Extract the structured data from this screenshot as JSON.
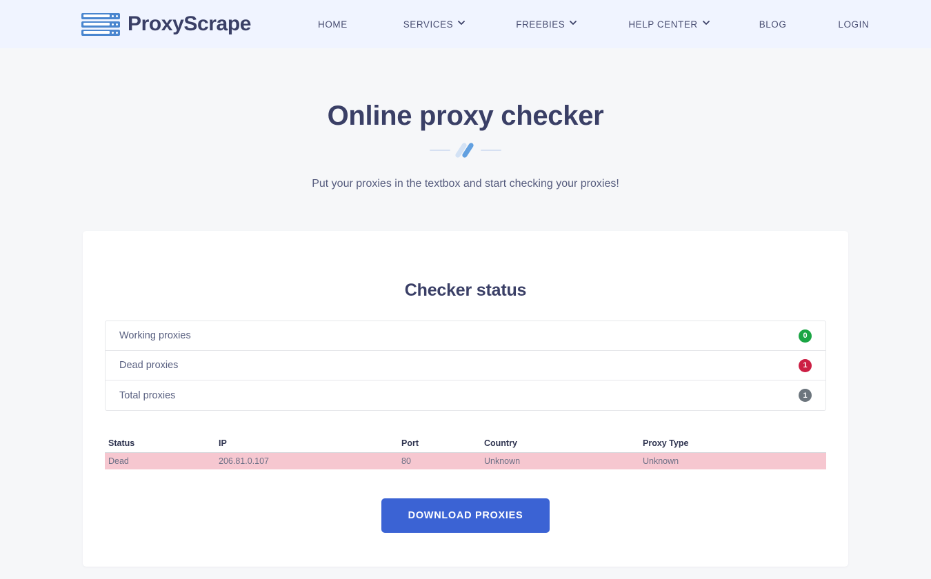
{
  "header": {
    "brand_name": "ProxyScrape",
    "logo_icon": "server-rack-icon",
    "nav": [
      {
        "label": "HOME",
        "has_caret": false
      },
      {
        "label": "SERVICES",
        "has_caret": true
      },
      {
        "label": "FREEBIES",
        "has_caret": true
      },
      {
        "label": "HELP CENTER",
        "has_caret": true
      },
      {
        "label": "BLOG",
        "has_caret": false
      },
      {
        "label": "LOGIN",
        "has_caret": false
      }
    ]
  },
  "hero": {
    "title": "Online proxy checker",
    "subtitle": "Put your proxies in the textbox and start checking your proxies!",
    "divider_icon": "double-slash-divider-icon"
  },
  "card": {
    "title": "Checker status",
    "status_rows": [
      {
        "label": "Working proxies",
        "count": "0",
        "color": "#1aa544"
      },
      {
        "label": "Dead proxies",
        "count": "1",
        "color": "#cc1f44"
      },
      {
        "label": "Total proxies",
        "count": "1",
        "color": "#6c757d"
      }
    ],
    "table": {
      "columns": [
        "Status",
        "IP",
        "Port",
        "Country",
        "Proxy Type"
      ],
      "rows": [
        {
          "status": "Dead",
          "ip": "206.81.0.107",
          "port": "80",
          "country": "Unknown",
          "proxy_type": "Unknown",
          "row_color": "#f6c7d0"
        }
      ]
    },
    "download_button": "DOWNLOAD PROXIES"
  },
  "colors": {
    "header_bg": "#f0f4ff",
    "page_bg": "#f6f7f9",
    "brand_text": "#3a3f66",
    "primary_button": "#3b63d4",
    "logo_blue": "#4a86cf"
  }
}
